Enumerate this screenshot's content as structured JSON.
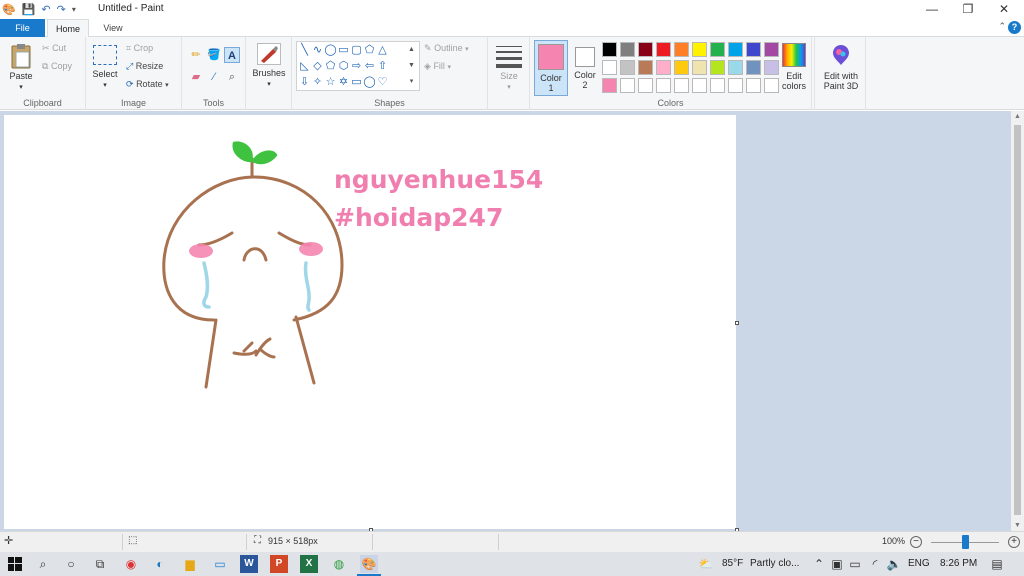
{
  "window": {
    "title": "Untitled - Paint",
    "minimize": "—",
    "restore": "❐",
    "close": "✕"
  },
  "tabs": {
    "file": "File",
    "home": "Home",
    "view": "View"
  },
  "ribbon": {
    "clipboard": {
      "label": "Clipboard",
      "paste": "Paste",
      "cut": "Cut",
      "copy": "Copy"
    },
    "image": {
      "label": "Image",
      "select": "Select",
      "crop": "Crop",
      "resize": "Resize",
      "rotate": "Rotate"
    },
    "tools": {
      "label": "Tools"
    },
    "brushes": "Brushes",
    "shapes": {
      "label": "Shapes",
      "outline": "Outline",
      "fill": "Fill"
    },
    "size": "Size",
    "color1": {
      "line1": "Color",
      "line2": "1",
      "value": "#f585b0"
    },
    "color2": {
      "line1": "Color",
      "line2": "2",
      "value": "#ffffff"
    },
    "colors": {
      "label": "Colors"
    },
    "edit_colors": {
      "line1": "Edit",
      "line2": "colors"
    },
    "edit_3d": {
      "line1": "Edit with",
      "line2": "Paint 3D"
    }
  },
  "palette": [
    "#000000",
    "#7f7f7f",
    "#880015",
    "#ed1c24",
    "#ff7f27",
    "#fff200",
    "#22b14c",
    "#00a2e8",
    "#3f48cc",
    "#a349a4",
    "#ffffff",
    "#c3c3c3",
    "#b97a57",
    "#ffaec9",
    "#ffc90e",
    "#efe4b0",
    "#b5e61d",
    "#99d9ea",
    "#7092be",
    "#c8bfe7",
    "#f585b0",
    "#ffffff",
    "#ffffff",
    "#ffffff",
    "#ffffff",
    "#ffffff",
    "#ffffff",
    "#ffffff",
    "#ffffff",
    "#ffffff"
  ],
  "canvas": {
    "text_line1": "nguyenhue154",
    "text_line2": "#hoidap247",
    "text_color": "#f07fb0",
    "stroke_color": "#a8714f",
    "tear_color": "#9fd6e8",
    "cheek_color": "#f585b0",
    "sprout_color": "#3fc23f"
  },
  "status": {
    "dimensions": "915 × 518px",
    "zoom": "100%"
  },
  "taskbar": {
    "temperature": "85°F",
    "weather": "Partly clo...",
    "language": "ENG",
    "time": "8:26 PM"
  }
}
